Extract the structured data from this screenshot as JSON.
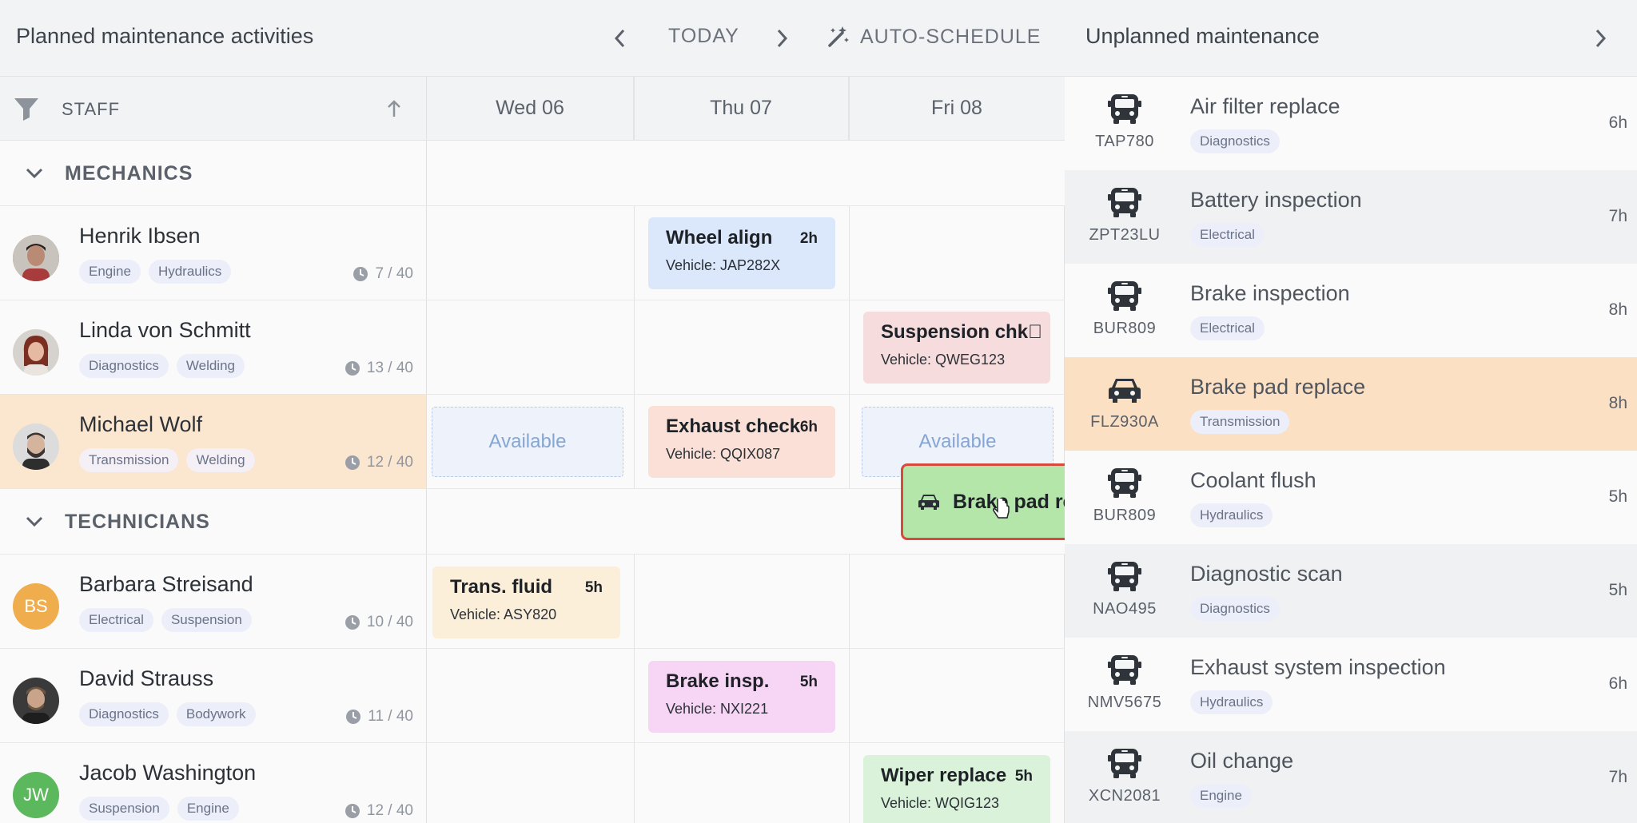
{
  "header": {
    "title": "Planned maintenance activities",
    "today_label": "TODAY",
    "auto_schedule_label": "AUTO-SCHEDULE"
  },
  "columns": {
    "staff_label": "STAFF",
    "days": [
      "Wed 06",
      "Thu 07",
      "Fri 08"
    ]
  },
  "groups": {
    "mechanics": "MECHANICS",
    "technicians": "TECHNICIANS"
  },
  "staff": [
    {
      "name": "Henrik Ibsen",
      "tags": [
        "Engine",
        "Hydraulics"
      ],
      "hours": "7 / 40",
      "initials": "",
      "avatar_color": "#8a6a5a"
    },
    {
      "name": "Linda von Schmitt",
      "tags": [
        "Diagnostics",
        "Welding"
      ],
      "hours": "13 / 40",
      "initials": "",
      "avatar_color": "#7a4a3a"
    },
    {
      "name": "Michael Wolf",
      "tags": [
        "Transmission",
        "Welding"
      ],
      "hours": "12 / 40",
      "initials": "",
      "avatar_color": "#5a5550"
    },
    {
      "name": "Barbara Streisand",
      "tags": [
        "Electrical",
        "Suspension"
      ],
      "hours": "10 / 40",
      "initials": "BS",
      "avatar_color": "#f0ad4e"
    },
    {
      "name": "David Strauss",
      "tags": [
        "Diagnostics",
        "Bodywork"
      ],
      "hours": "11 / 40",
      "initials": "",
      "avatar_color": "#4a4540"
    },
    {
      "name": "Jacob Washington",
      "tags": [
        "Suspension",
        "Engine"
      ],
      "hours": "12 / 40",
      "initials": "JW",
      "avatar_color": "#5cb85c"
    }
  ],
  "events": [
    {
      "name": "Wheel align",
      "duration": "2h",
      "vehicle": "Vehicle: JAP282X",
      "color": "#dbe7fb"
    },
    {
      "name": "Suspension chk\u0000",
      "duration": "",
      "vehicle": "Vehicle: QWEG123",
      "color": "#f6dcdc"
    },
    {
      "name": "Exhaust check",
      "duration": "6h",
      "vehicle": "Vehicle: QQIX087",
      "color": "#fae0d6"
    },
    {
      "name": "Trans. fluid",
      "duration": "5h",
      "vehicle": "Vehicle: ASY820",
      "color": "#fcefd9"
    },
    {
      "name": "Brake insp.",
      "duration": "5h",
      "vehicle": "Vehicle: NXI221",
      "color": "#f7d6f5"
    },
    {
      "name": "Wiper replace",
      "duration": "5h",
      "vehicle": "Vehicle: WQIG123",
      "color": "#d9f2d9"
    }
  ],
  "available_label": "Available",
  "dragging": {
    "label": "Brake pad rep"
  },
  "unplanned": {
    "title": "Unplanned maintenance",
    "items": [
      {
        "title": "Air filter replace",
        "tag": "Diagnostics",
        "plate": "TAP780",
        "hours": "6h",
        "icon": "bus-icon"
      },
      {
        "title": "Battery inspection",
        "tag": "Electrical",
        "plate": "ZPT23LU",
        "hours": "7h",
        "icon": "bus-icon"
      },
      {
        "title": "Brake inspection",
        "tag": "Electrical",
        "plate": "BUR809",
        "hours": "8h",
        "icon": "bus-icon"
      },
      {
        "title": "Brake pad replace",
        "tag": "Transmission",
        "plate": "FLZ930A",
        "hours": "8h",
        "icon": "car-icon"
      },
      {
        "title": "Coolant flush",
        "tag": "Hydraulics",
        "plate": "BUR809",
        "hours": "5h",
        "icon": "bus-icon"
      },
      {
        "title": "Diagnostic scan",
        "tag": "Diagnostics",
        "plate": "NAO495",
        "hours": "5h",
        "icon": "bus-icon"
      },
      {
        "title": "Exhaust system inspection",
        "tag": "Hydraulics",
        "plate": "NMV5675",
        "hours": "6h",
        "icon": "bus-icon"
      },
      {
        "title": "Oil change",
        "tag": "Engine",
        "plate": "XCN2081",
        "hours": "7h",
        "icon": "bus-icon"
      }
    ]
  }
}
